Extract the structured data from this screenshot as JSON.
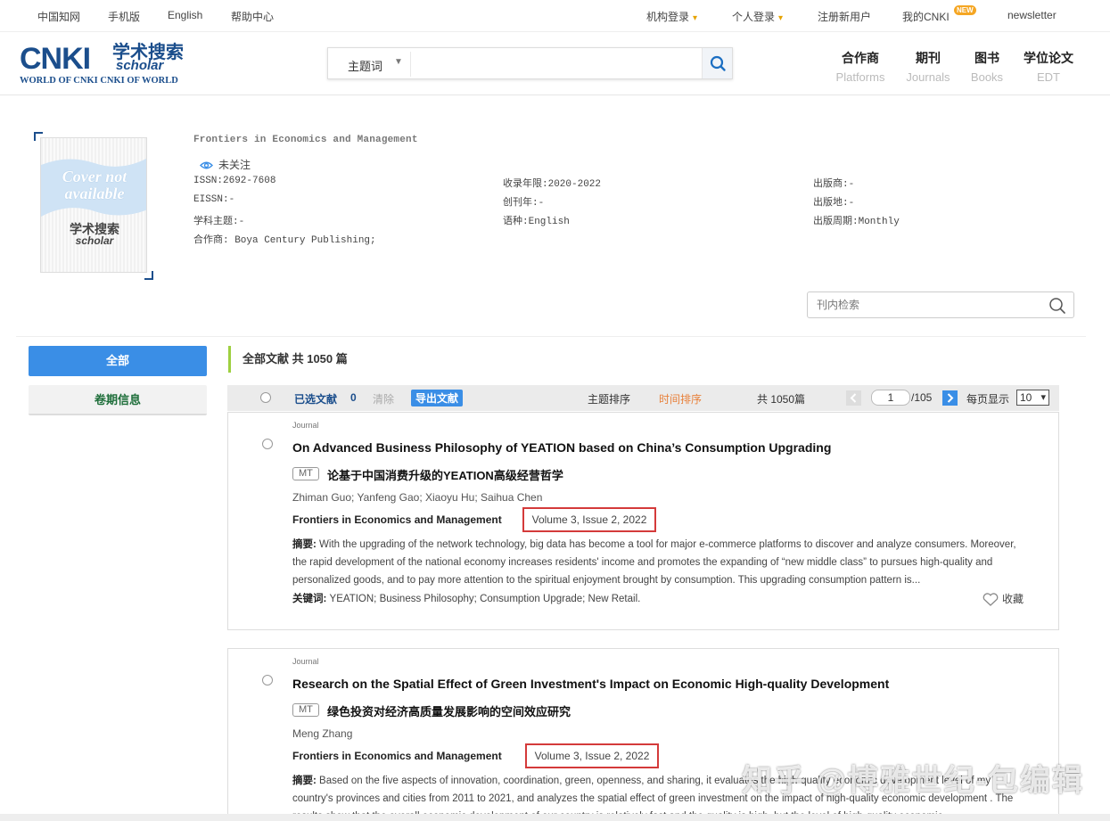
{
  "topbar": {
    "cnki_home": "中国知网",
    "mobile": "手机版",
    "english": "English",
    "help": "帮助中心",
    "institution_login": "机构登录",
    "personal_login": "个人登录",
    "register": "注册新用户",
    "my_cnki": "我的CNKI",
    "my_cnki_badge": "NEW",
    "newsletter": "newsletter"
  },
  "logo": {
    "main": "CNKI",
    "cn": "学术搜索",
    "scholar": "scholar",
    "subtitle": "WORLD OF CNKI CNKI OF WORLD"
  },
  "search": {
    "field": "主题词",
    "value": "",
    "icon": "search-icon"
  },
  "nav": [
    {
      "zh": "合作商",
      "en": "Platforms"
    },
    {
      "zh": "期刊",
      "en": "Journals"
    },
    {
      "zh": "图书",
      "en": "Books"
    },
    {
      "zh": "学位论文",
      "en": "EDT"
    }
  ],
  "journal": {
    "cover_text1": "Cover not",
    "cover_text2": "available",
    "cover_cn": "学术搜索",
    "cover_sch": "scholar",
    "title": "Frontiers in Economics and Management",
    "follow_label": "未关注",
    "issn": "ISSN:2692-7608",
    "eissn": "EISSN:-",
    "subject": "学科主题:-",
    "partner": "合作商: Boya Century Publishing;",
    "years": "收录年限:2020-2022",
    "founded": "创刊年:-",
    "language": "语种:English",
    "publisher": "出版商:-",
    "place": "出版地:-",
    "frequency": "出版周期:Monthly"
  },
  "inner_search": {
    "placeholder": "刊内检索"
  },
  "left_menu": {
    "all": "全部",
    "issues": "卷期信息"
  },
  "results": {
    "heading": "全部文献 共 1050 篇"
  },
  "toolbar": {
    "selected_label": "已选文献",
    "selected_count": "0",
    "clear": "清除",
    "export": "导出文献",
    "sort_topic": "主题排序",
    "sort_time": "时间排序",
    "total": "共 1050篇",
    "page": "1",
    "page_total": "/105",
    "per_page_label": "每页显示",
    "per_page": "10"
  },
  "articles": [
    {
      "type": "Journal",
      "title": "On Advanced Business Philosophy of YEATION based on China’s Consumption Upgrading",
      "mt": "MT",
      "title_cn": "论基于中国消费升级的YEATION高级经营哲学",
      "authors": "Zhiman Guo; Yanfeng Gao; Xiaoyu Hu; Saihua Chen",
      "source": "Frontiers in Economics and Management",
      "volume": "Volume 3, Issue 2, 2022",
      "abstract_label": "摘要:",
      "abstract": "With the upgrading of the network technology, big data has become a tool for major e-commerce platforms to discover and analyze consumers. Moreover, the rapid development of the national economy increases residents' income and promotes the expanding of “new middle class” to pursues high-quality and personalized goods, and to pay more attention to the spiritual enjoyment brought by consumption. This upgrading consumption pattern is...",
      "keywords_label": "关键词:",
      "keywords": "YEATION; Business Philosophy; Consumption Upgrade; New Retail.",
      "favorite": "收藏"
    },
    {
      "type": "Journal",
      "title": "Research on the Spatial Effect of Green Investment's Impact on Economic High-quality Development",
      "mt": "MT",
      "title_cn": "绿色投资对经济高质量发展影响的空间效应研究",
      "authors": "Meng Zhang",
      "source": "Frontiers in Economics and Management",
      "volume": "Volume 3, Issue 2, 2022",
      "abstract_label": "摘要:",
      "abstract": "Based on the five aspects of innovation, coordination, green, openness, and sharing, it evaluates the high-quality economic development level of my country's provinces and cities from 2011 to 2021, and analyzes the spatial effect of green investment on the impact of high-quality economic development . The results show that the overall economic development of our country is relatively fast and the quality is high, but the level of high-quality economic..."
    }
  ],
  "watermark": "知乎 @博雅世纪-包编辑",
  "colors": {
    "brand": "#1b4e8c",
    "accent": "#3a8ee6",
    "highlight_box": "#d43a3a",
    "sort_active": "#e8803a"
  }
}
